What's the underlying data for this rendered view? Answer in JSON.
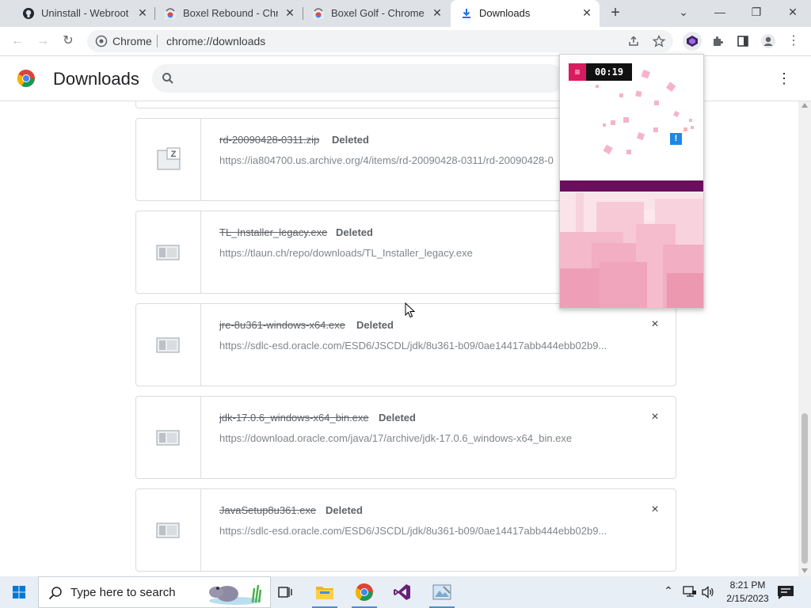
{
  "browser": {
    "tabs": [
      {
        "title": "Uninstall - Webroot",
        "favicon": "github-icon",
        "active": false
      },
      {
        "title": "Boxel Rebound - Chrom",
        "favicon": "chrome-webstore-icon",
        "active": false
      },
      {
        "title": "Boxel Golf - Chrome W",
        "favicon": "chrome-webstore-icon",
        "active": false
      },
      {
        "title": "Downloads",
        "favicon": "download-icon",
        "active": true
      }
    ],
    "new_tab_label": "+",
    "omnibox": {
      "site_label": "Chrome",
      "url": "chrome://downloads"
    }
  },
  "downloads_page": {
    "title": "Downloads",
    "items": [
      {
        "filename": "rd-20090428-0311.zip",
        "status": "Deleted",
        "url": "https://ia804700.us.archive.org/4/items/rd-20090428-0311/rd-20090428-0",
        "icon": "zip-file-icon",
        "remove_label": "×"
      },
      {
        "filename": "TL_Installer_legacy.exe",
        "status": "Deleted",
        "url": "https://tlaun.ch/repo/downloads/TL_Installer_legacy.exe",
        "icon": "generic-file-icon",
        "remove_label": "×"
      },
      {
        "filename": "jre-8u361-windows-x64.exe",
        "status": "Deleted",
        "url": "https://sdlc-esd.oracle.com/ESD6/JSCDL/jdk/8u361-b09/0ae14417abb444ebb02b9...",
        "icon": "generic-file-icon",
        "remove_label": "×"
      },
      {
        "filename": "jdk-17.0.6_windows-x64_bin.exe",
        "status": "Deleted",
        "url": "https://download.oracle.com/java/17/archive/jdk-17.0.6_windows-x64_bin.exe",
        "icon": "generic-file-icon",
        "remove_label": "×"
      },
      {
        "filename": "JavaSetup8u361.exe",
        "status": "Deleted",
        "url": "https://sdlc-esd.oracle.com/ESD6/JSCDL/jdk/8u361-b09/0ae14417abb444ebb02b9...",
        "icon": "generic-file-icon",
        "remove_label": "×"
      }
    ]
  },
  "extension_popup": {
    "menu_label": "≡",
    "timer": "00:19",
    "alert_label": "!",
    "colors": {
      "accent": "#d81b60",
      "bar": "#6a0e5e",
      "blocks": "#f4a7c0"
    }
  },
  "taskbar": {
    "search_placeholder": "Type here to search",
    "clock_time": "8:21 PM",
    "clock_date": "2/15/2023"
  }
}
